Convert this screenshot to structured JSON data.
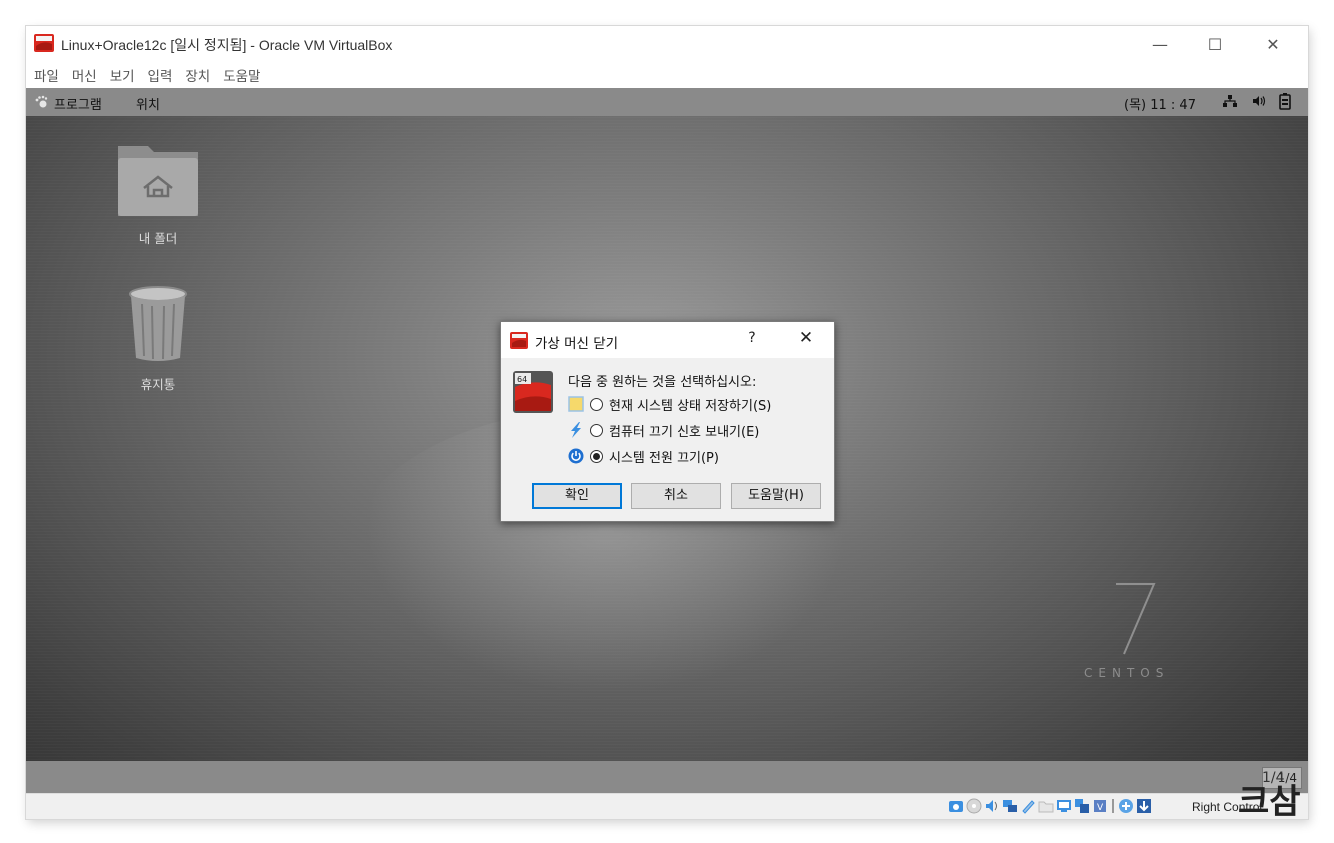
{
  "window": {
    "title": "Linux+Oracle12c [일시 정지됨] - Oracle VM VirtualBox",
    "controls": {
      "minimize": "—",
      "maximize": "☐",
      "close": "✕"
    }
  },
  "menubar": [
    "파일",
    "머신",
    "보기",
    "입력",
    "장치",
    "도움말"
  ],
  "guest": {
    "panel": {
      "applications": "프로그램",
      "places": "위치",
      "clock": "(목) 11 : 47"
    },
    "desktop_icons": [
      {
        "label": "내 폴더",
        "icon": "home-folder-icon"
      },
      {
        "label": "휴지통",
        "icon": "trash-icon"
      }
    ],
    "branding": {
      "number": "7",
      "word": "CENTOS"
    },
    "workspace_indicator": "1/4"
  },
  "dialog": {
    "title": "가상 머신 닫기",
    "help_symbol": "?",
    "close_symbol": "✕",
    "prompt": "다음 중 원하는 것을 선택하십시오:",
    "options": [
      {
        "label": "현재 시스템 상태 저장하기(S)",
        "icon": "save-state-icon",
        "checked": false
      },
      {
        "label": "컴퓨터 끄기 신호 보내기(E)",
        "icon": "acpi-shutdown-icon",
        "checked": false
      },
      {
        "label": "시스템 전원 끄기(P)",
        "icon": "power-off-icon",
        "checked": true
      }
    ],
    "buttons": {
      "ok": "확인",
      "cancel": "취소",
      "help": "도움말(H)"
    }
  },
  "statusbar": {
    "host_key": "Right Control"
  },
  "overlay": {
    "page_indicator": "1/4",
    "glyph": "크삼"
  },
  "colors": {
    "panel_gray": "#8a8a8a",
    "dialog_bg": "#f0f0f0",
    "focus_blue": "#0078d7",
    "vbox_red": "#d9281f"
  }
}
